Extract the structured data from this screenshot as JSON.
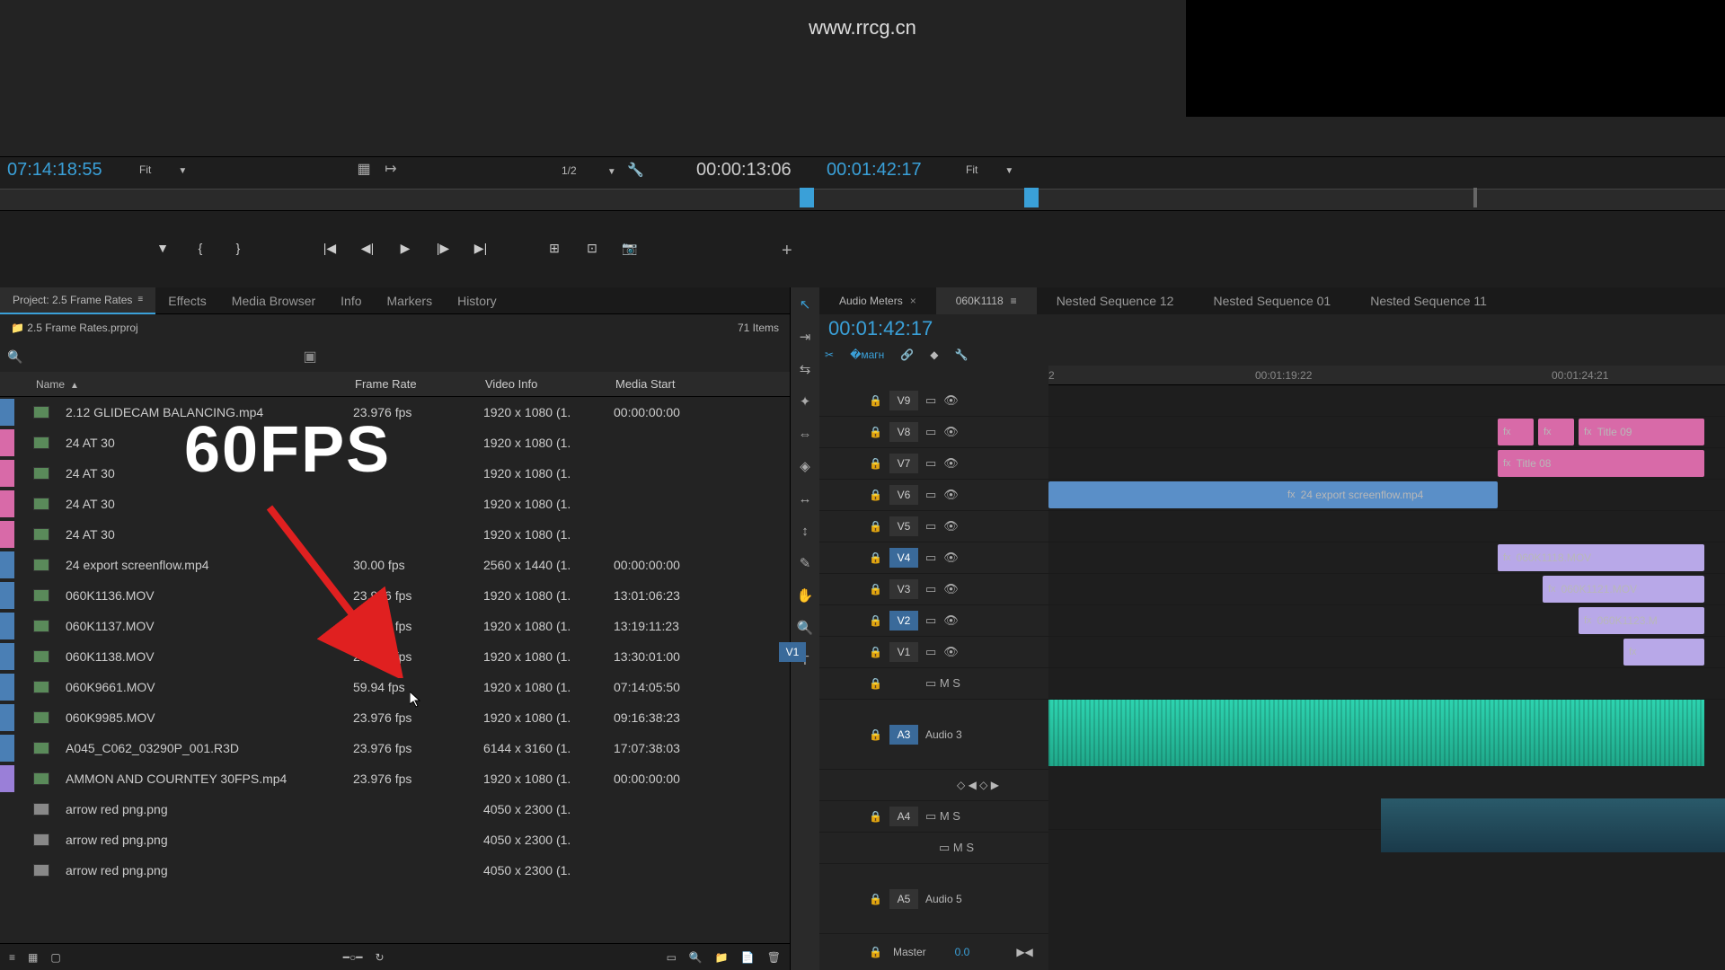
{
  "watermark_url": "www.rrcg.cn",
  "source_monitor": {
    "timecode": "07:14:18:55",
    "fit_label": "Fit",
    "resolution": "1/2",
    "duration": "00:00:13:06"
  },
  "program_monitor": {
    "timecode": "00:01:42:17",
    "fit_label": "Fit"
  },
  "panel_tabs": [
    {
      "label": "Project: 2.5 Frame Rates",
      "active": true
    },
    {
      "label": "Effects",
      "active": false
    },
    {
      "label": "Media Browser",
      "active": false
    },
    {
      "label": "Info",
      "active": false
    },
    {
      "label": "Markers",
      "active": false
    },
    {
      "label": "History",
      "active": false
    }
  ],
  "project_file": "2.5 Frame Rates.prproj",
  "item_count": "71 Items",
  "columns": {
    "name": "Name",
    "frame_rate": "Frame Rate",
    "video_info": "Video Info",
    "media_start": "Media Start"
  },
  "rows": [
    {
      "chip": "blue",
      "name": "2.12 GLIDECAM BALANCING.mp4",
      "fr": "23.976 fps",
      "vi": "1920 x 1080 (1.",
      "ms": "00:00:00:00"
    },
    {
      "chip": "pink",
      "name": "24 AT 30",
      "fr": "",
      "vi": "1920 x 1080 (1.",
      "ms": ""
    },
    {
      "chip": "pink",
      "name": "24 AT 30",
      "fr": "",
      "vi": "1920 x 1080 (1.",
      "ms": ""
    },
    {
      "chip": "pink",
      "name": "24 AT 30",
      "fr": "",
      "vi": "1920 x 1080 (1.",
      "ms": ""
    },
    {
      "chip": "pink",
      "name": "24 AT 30",
      "fr": "",
      "vi": "1920 x 1080 (1.",
      "ms": ""
    },
    {
      "chip": "blue",
      "name": "24 export screenflow.mp4",
      "fr": "30.00 fps",
      "vi": "2560 x 1440 (1.",
      "ms": "00:00:00:00"
    },
    {
      "chip": "blue",
      "name": "060K1136.MOV",
      "fr": "23.976 fps",
      "vi": "1920 x 1080 (1.",
      "ms": "13:01:06:23"
    },
    {
      "chip": "blue",
      "name": "060K1137.MOV",
      "fr": "23.976 fps",
      "vi": "1920 x 1080 (1.",
      "ms": "13:19:11:23"
    },
    {
      "chip": "blue",
      "name": "060K1138.MOV",
      "fr": "23.976 fps",
      "vi": "1920 x 1080 (1.",
      "ms": "13:30:01:00"
    },
    {
      "chip": "blue",
      "name": "060K9661.MOV",
      "fr": "59.94 fps",
      "vi": "1920 x 1080 (1.",
      "ms": "07:14:05:50"
    },
    {
      "chip": "blue",
      "name": "060K9985.MOV",
      "fr": "23.976 fps",
      "vi": "1920 x 1080 (1.",
      "ms": "09:16:38:23"
    },
    {
      "chip": "blue",
      "name": "A045_C062_03290P_001.R3D",
      "fr": "23.976 fps",
      "vi": "6144 x 3160 (1.",
      "ms": "17:07:38:03"
    },
    {
      "chip": "violet",
      "name": "AMMON AND COURNTEY 30FPS.mp4",
      "fr": "23.976 fps",
      "vi": "1920 x 1080 (1.",
      "ms": "00:00:00:00"
    },
    {
      "chip": "none",
      "name": "arrow red png.png",
      "fr": "",
      "vi": "4050 x 2300 (1.",
      "ms": ""
    },
    {
      "chip": "none",
      "name": "arrow red png.png",
      "fr": "",
      "vi": "4050 x 2300 (1.",
      "ms": ""
    },
    {
      "chip": "none",
      "name": "arrow red png.png",
      "fr": "",
      "vi": "4050 x 2300 (1.",
      "ms": ""
    }
  ],
  "annotation_text": "60FPS",
  "timeline_tabs": [
    {
      "label": "Audio Meters",
      "active": false,
      "closable": true
    },
    {
      "label": "060K1118",
      "active": true,
      "closable": false
    },
    {
      "label": "Nested Sequence 12",
      "active": false,
      "closable": false
    },
    {
      "label": "Nested Sequence 01",
      "active": false,
      "closable": false
    },
    {
      "label": "Nested Sequence 11",
      "active": false,
      "closable": false
    }
  ],
  "timeline_tc": "00:01:42:17",
  "ruler_marks": [
    {
      "label": "2",
      "pos": 0
    },
    {
      "label": "00:01:19:22",
      "pos": 230
    },
    {
      "label": "00:01:24:21",
      "pos": 560
    }
  ],
  "video_tracks": [
    "V9",
    "V8",
    "V7",
    "V6",
    "V5",
    "V4",
    "V3",
    "V2",
    "V1"
  ],
  "audio_tracks": [
    {
      "label": "Audio 3",
      "id": "A3",
      "tall": true
    },
    {
      "label": "",
      "id": "A4",
      "tall": false
    },
    {
      "label": "Audio 5",
      "id": "A5",
      "tall": true
    }
  ],
  "clips": {
    "title09": "Title 09",
    "title08": "Title 08",
    "screenflow": "24 export screenflow.mp4",
    "c1118": "060K1118.MOV",
    "c1121": "060K1121.MOV",
    "c1123": "060K1123.M"
  },
  "master": {
    "label": "Master",
    "value": "0.0"
  },
  "src_label": "V1"
}
